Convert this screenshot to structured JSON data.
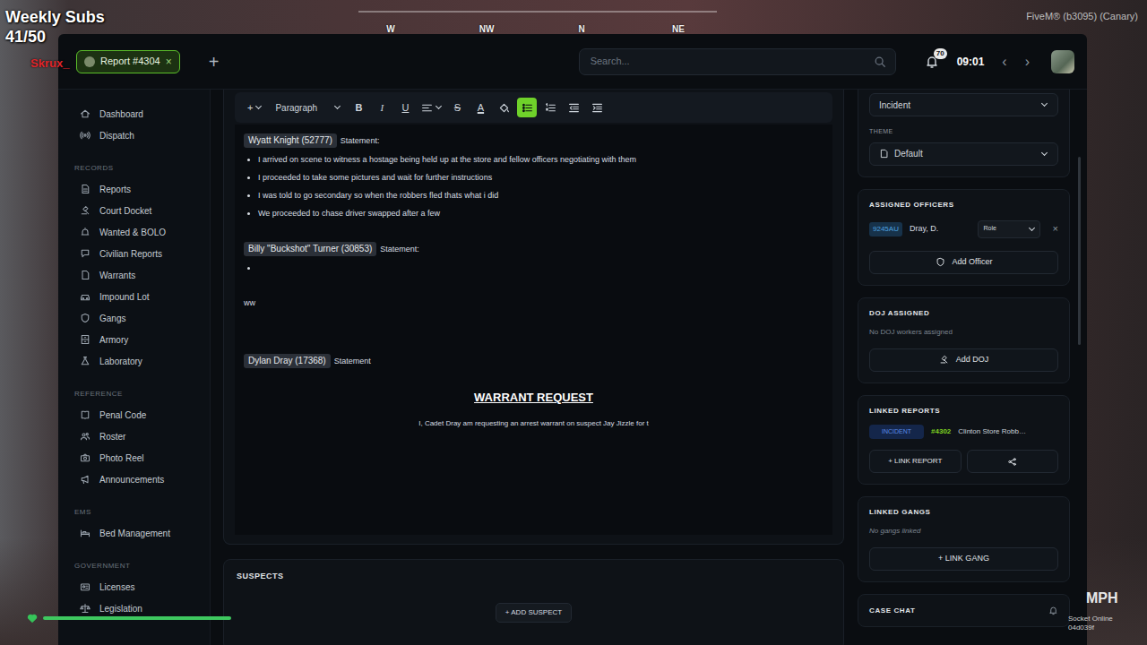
{
  "hud": {
    "subs_label": "Weekly Subs",
    "subs_count": "41/50",
    "player": "Skrux_",
    "compass": [
      "W",
      "NW",
      "N",
      "NE"
    ],
    "build": "FiveM® (b3095) (Canary)",
    "speed_unit": "MPH",
    "socket_status": "Socket Online",
    "socket_id": "04d039f"
  },
  "topbar": {
    "tabs": [
      {
        "label": "Report #4304",
        "close": "×",
        "selected": true
      }
    ],
    "new_tab": "+",
    "search": {
      "placeholder": "Search..."
    },
    "notifications": "70",
    "time": "09:01",
    "back": "‹",
    "forward": "›"
  },
  "sidebar": {
    "top_items": [
      {
        "label": "Dashboard",
        "selected": false
      },
      {
        "label": "Dispatch",
        "selected": false
      }
    ],
    "sections": [
      {
        "title": "RECORDS",
        "items": [
          {
            "label": "Reports",
            "selected": false
          },
          {
            "label": "Court Docket",
            "selected": false
          },
          {
            "label": "Wanted & BOLO",
            "selected": false
          },
          {
            "label": "Civilian Reports",
            "selected": false
          },
          {
            "label": "Warrants",
            "selected": false
          },
          {
            "label": "Impound Lot",
            "selected": false
          },
          {
            "label": "Gangs",
            "selected": false
          },
          {
            "label": "Armory",
            "selected": false
          },
          {
            "label": "Laboratory",
            "selected": false
          }
        ]
      },
      {
        "title": "REFERENCE",
        "items": [
          {
            "label": "Penal Code",
            "selected": false
          },
          {
            "label": "Roster",
            "selected": false
          },
          {
            "label": "Photo Reel",
            "selected": false
          },
          {
            "label": "Announcements",
            "selected": false
          }
        ]
      },
      {
        "title": "EMS",
        "items": [
          {
            "label": "Bed Management",
            "selected": false
          }
        ]
      },
      {
        "title": "GOVERNMENT",
        "items": [
          {
            "label": "Licenses",
            "selected": false
          },
          {
            "label": "Legislation",
            "selected": false
          }
        ]
      }
    ]
  },
  "editor": {
    "toolbar": [
      {
        "kind": "menu",
        "label": "+",
        "selected": false
      },
      {
        "kind": "menu",
        "label": "Paragraph",
        "selected": false
      },
      {
        "kind": "bold",
        "label": "B",
        "selected": false
      },
      {
        "kind": "italic",
        "label": "I",
        "selected": false
      },
      {
        "kind": "underline",
        "label": "U",
        "selected": false
      },
      {
        "kind": "iconmenu",
        "selected": false
      },
      {
        "kind": "strike",
        "label": "S",
        "selected": false
      },
      {
        "kind": "color",
        "label": "A",
        "selected": false
      },
      {
        "kind": "icon",
        "selected": false
      },
      {
        "kind": "icon",
        "selected": true
      },
      {
        "kind": "icon",
        "selected": false
      },
      {
        "kind": "icon",
        "selected": false
      },
      {
        "kind": "icon",
        "selected": false
      }
    ],
    "blocks": [
      {
        "kind": "statement",
        "person": "Wyatt Knight (52777)",
        "label": "Statement:",
        "bullets": [
          "I arrived on scene to witness a hostage being held up at the store and fellow officers negotiating with them",
          "I proceeded to take some pictures and wait for further instructions",
          "I was told to go secondary so when the robbers fled thats what i did",
          "We proceeded to chase driver swapped after a few"
        ]
      },
      {
        "kind": "statement",
        "person": "Billy \"Buckshot\" Turner (30853)",
        "label": "Statement:",
        "bullets": [
          ""
        ]
      },
      {
        "kind": "paragraph",
        "text": "ww"
      },
      {
        "kind": "statement",
        "person": "Dylan Dray (17368)",
        "label": "Statement",
        "bullets": []
      },
      {
        "kind": "heading",
        "text": "WARRANT REQUEST"
      },
      {
        "kind": "centered",
        "text": "I, Cadet Dray am requesting an arrest warrant on suspect Jay Jizzle for t"
      }
    ]
  },
  "suspects": {
    "title": "SUSPECTS",
    "add": "+ ADD SUSPECT"
  },
  "details": {
    "type": "Incident",
    "theme_label": "THEME",
    "theme": "Default"
  },
  "assigned_officers": {
    "title": "ASSIGNED OFFICERS",
    "officers": [
      {
        "callsign": "9245AU",
        "name": "Dray, D.",
        "role": "Role",
        "remove": "×"
      }
    ],
    "add": "Add Officer"
  },
  "doj": {
    "title": "DOJ ASSIGNED",
    "empty": "No DOJ workers assigned",
    "add": "Add DOJ"
  },
  "linked_reports": {
    "title": "LINKED REPORTS",
    "reports": [
      {
        "type": "INCIDENT",
        "id": "#4302",
        "title": "Clinton Store Robb…"
      }
    ],
    "add": "+ LINK REPORT"
  },
  "linked_gangs": {
    "title": "LINKED GANGS",
    "empty": "No gangs linked",
    "add": "+ LINK GANG"
  },
  "case_chat": {
    "title": "CASE CHAT"
  }
}
